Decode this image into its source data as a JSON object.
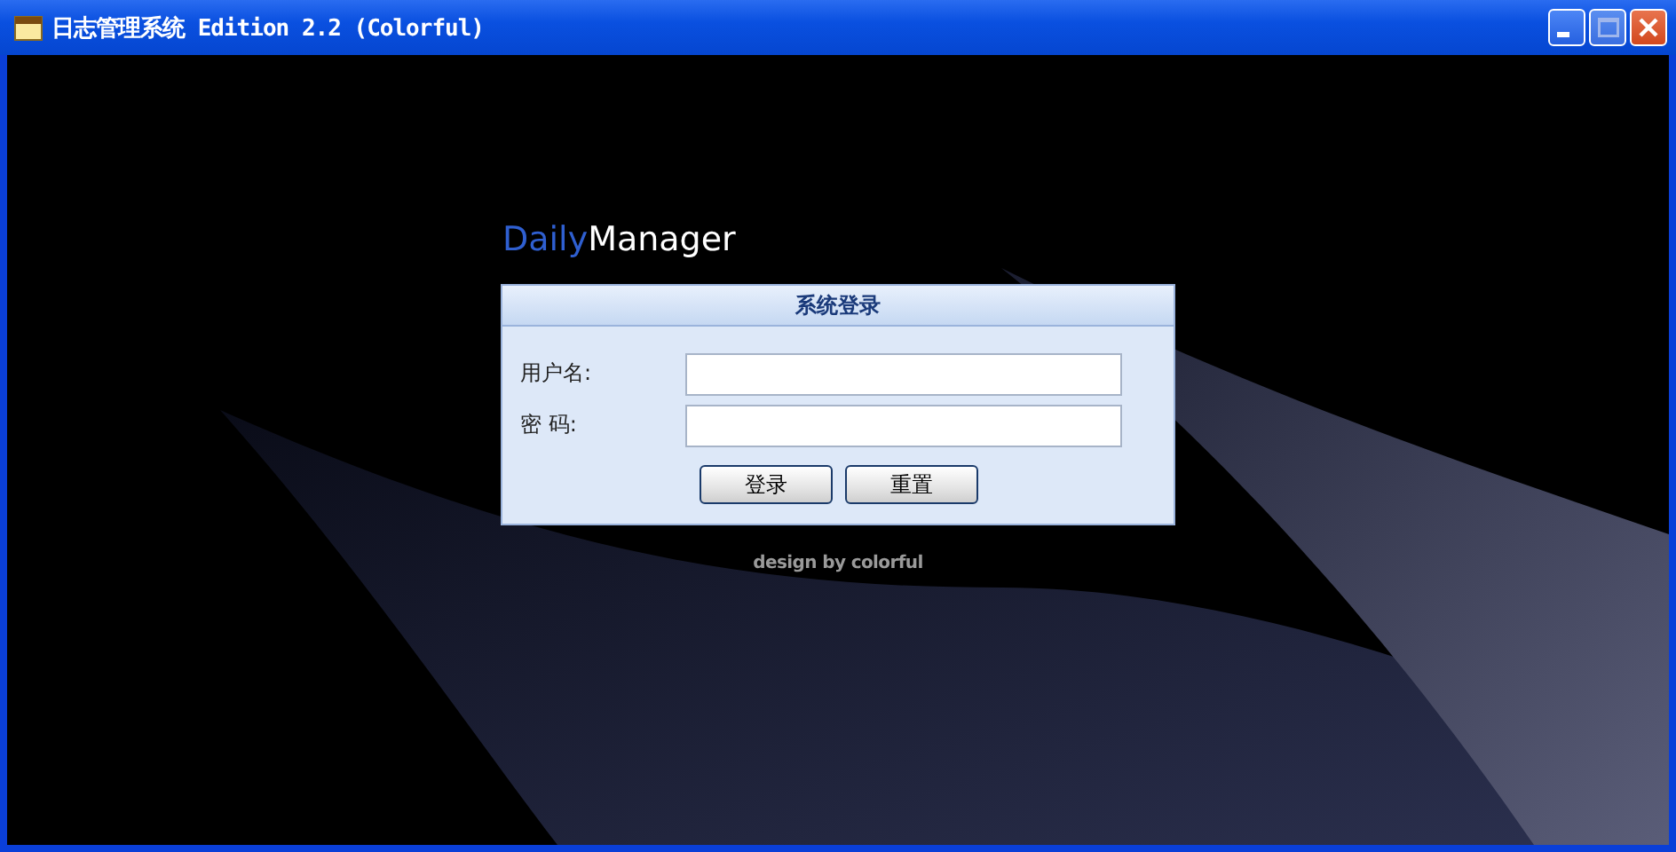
{
  "window": {
    "title": "日志管理系统 Edition 2.2 (Colorful)"
  },
  "logo": {
    "first": "Daily",
    "second": "Manager"
  },
  "login": {
    "title": "系统登录",
    "fields": [
      {
        "label": "用户名:"
      },
      {
        "label": "密 码:"
      }
    ],
    "buttons": [
      "登录",
      "重置"
    ]
  },
  "footer": "design by colorful"
}
